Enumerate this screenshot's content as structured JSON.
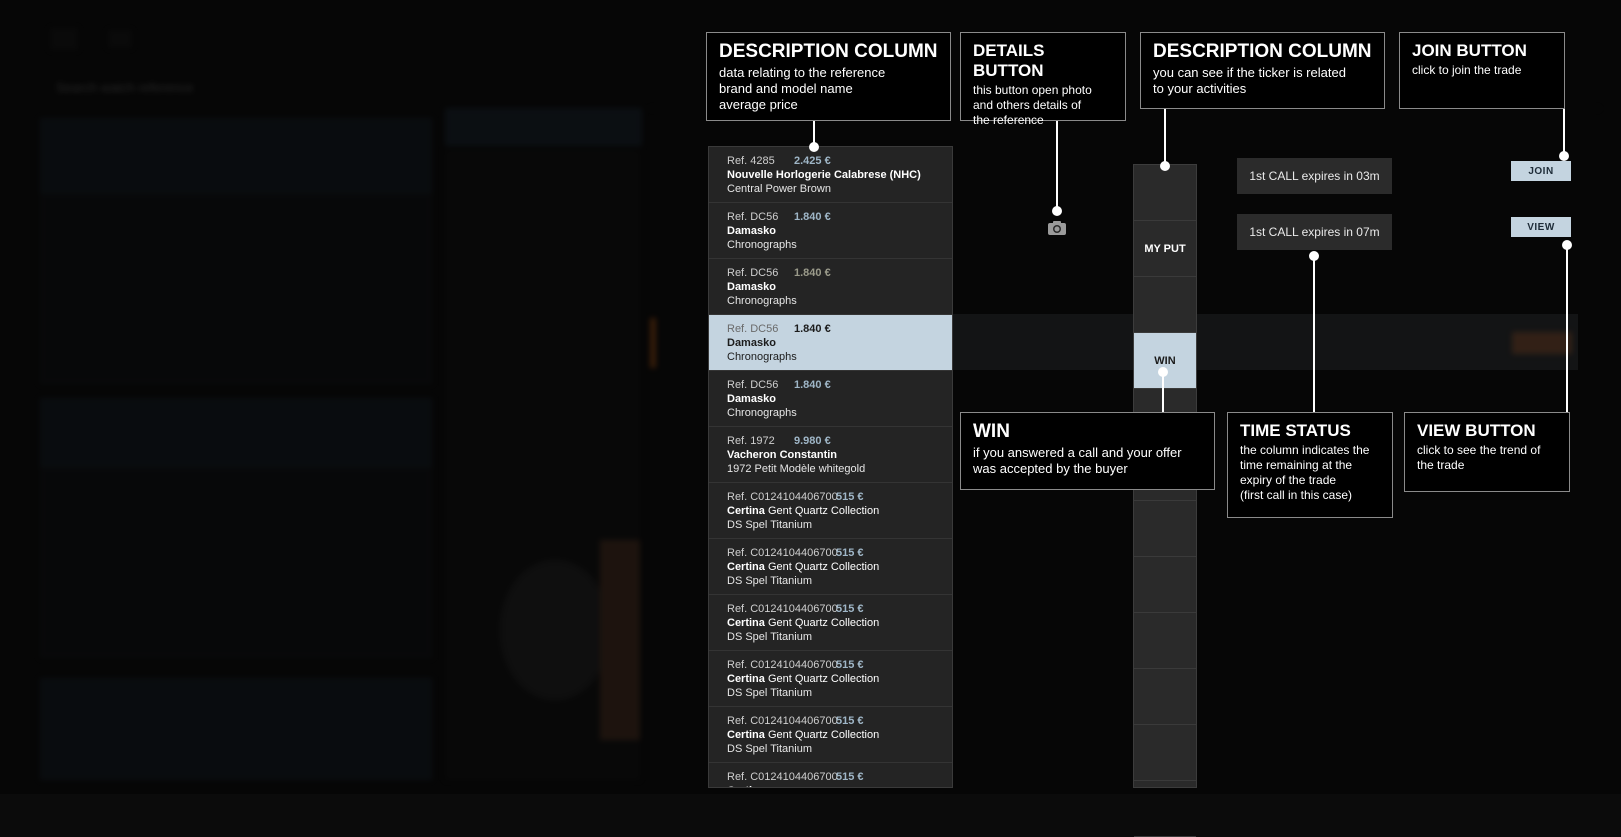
{
  "colors": {
    "highlight": "#c4d4e0",
    "callout_bg": "#000000",
    "list_bg": "#242424",
    "accent_price": "#9fb6c7",
    "orange": "#7a3a12"
  },
  "background": {
    "search_placeholder": "Search watch reference"
  },
  "description_list": {
    "rows": [
      {
        "ref": "Ref. 4285",
        "price": "2.425 €",
        "brand": "Nouvelle Horlogerie Calabrese (NHC)",
        "brand_rest": "",
        "model": "Central Power Brown",
        "price_style": "accent"
      },
      {
        "ref": "Ref. DC56",
        "price": "1.840 €",
        "brand": "Damasko",
        "brand_rest": "",
        "model": "Chronographs",
        "price_style": "accent"
      },
      {
        "ref": "Ref. DC56",
        "price": "1.840 €",
        "brand": "Damasko",
        "brand_rest": "",
        "model": "Chronographs",
        "price_style": "grey"
      },
      {
        "ref": "Ref. DC56",
        "price": "1.840 €",
        "brand": "Damasko",
        "brand_rest": "",
        "model": "Chronographs",
        "price_style": "white",
        "highlighted": true
      },
      {
        "ref": "Ref. DC56",
        "price": "1.840 €",
        "brand": "Damasko",
        "brand_rest": "",
        "model": "Chronographs",
        "price_style": "accent"
      },
      {
        "ref": "Ref. 1972",
        "price": "9.980 €",
        "brand": "Vacheron Constantin",
        "brand_rest": "",
        "model": "1972 Petit Modèle whitegold",
        "price_style": "accent"
      },
      {
        "ref": "Ref. C0124104406700",
        "price": "515 €",
        "brand": "Certina",
        "brand_rest": " Gent Quartz Collection",
        "model": "DS Spel Titanium",
        "price_style": "accent"
      },
      {
        "ref": "Ref. C0124104406700",
        "price": "515 €",
        "brand": "Certina",
        "brand_rest": " Gent Quartz Collection",
        "model": "DS Spel Titanium",
        "price_style": "accent"
      },
      {
        "ref": "Ref. C0124104406700",
        "price": "515 €",
        "brand": "Certina",
        "brand_rest": " Gent Quartz Collection",
        "model": "DS Spel Titanium",
        "price_style": "accent"
      },
      {
        "ref": "Ref. C0124104406700",
        "price": "515 €",
        "brand": "Certina",
        "brand_rest": " Gent Quartz Collection",
        "model": "DS Spel Titanium",
        "price_style": "accent"
      },
      {
        "ref": "Ref. C0124104406700",
        "price": "515 €",
        "brand": "Certina",
        "brand_rest": " Gent Quartz Collection",
        "model": "DS Spel Titanium",
        "price_style": "accent"
      },
      {
        "ref": "Ref. C0124104406700",
        "price": "515 €",
        "brand": "Certina",
        "brand_rest": "",
        "model": "",
        "price_style": "accent"
      }
    ]
  },
  "details_icon": "camera-icon",
  "status_column": {
    "cells": [
      "",
      "MY PUT",
      "",
      "WIN",
      "",
      "",
      "",
      "",
      "",
      "",
      "",
      ""
    ]
  },
  "time_chips": [
    "1st CALL expires in 03m",
    "1st CALL expires in 07m"
  ],
  "actions": {
    "join": "JOIN",
    "view": "VIEW"
  },
  "callouts": {
    "description_left": {
      "title": "DESCRIPTION COLUMN",
      "body": "data relating to the reference\nbrand  and model name\naverage price"
    },
    "details_button": {
      "title": "DETAILS BUTTON",
      "body": "this button open photo\nand others details of\nthe reference"
    },
    "description_right": {
      "title": "DESCRIPTION COLUMN",
      "body": "you can see if the ticker is related\nto your activities"
    },
    "join_button": {
      "title": "JOIN BUTTON",
      "body": "click to join the trade"
    },
    "win": {
      "title": "WIN",
      "body": "if you answered a call and your offer\nwas accepted by the buyer"
    },
    "time_status": {
      "title": "TIME STATUS",
      "body": "the column indicates the\ntime remaining at the\nexpiry of the trade\n(first call in this case)"
    },
    "view_button": {
      "title": "VIEW BUTTON",
      "body": "click to see the trend of\nthe trade"
    }
  }
}
